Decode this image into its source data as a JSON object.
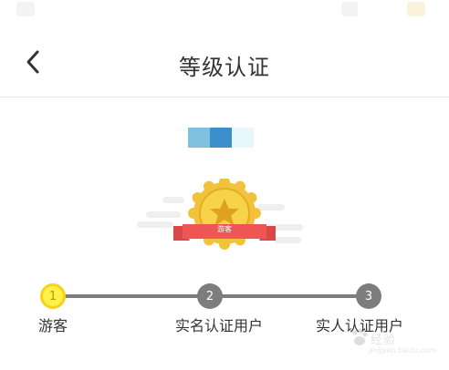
{
  "header": {
    "title": "等级认证",
    "back_icon": "chevron-left-icon"
  },
  "level": {
    "badge_text": "游客",
    "badge_colors": {
      "gold": "#F2C33A",
      "gold_light": "#F7D34A",
      "ribbon": "#EE5555"
    }
  },
  "steps": [
    {
      "number": "1",
      "label": "游客",
      "state": "current"
    },
    {
      "number": "2",
      "label": "实名认证用户",
      "state": "pending"
    },
    {
      "number": "3",
      "label": "实人认证用户",
      "state": "pending"
    }
  ],
  "watermark": {
    "brand": "经验",
    "site": "jingyan.baidu.com"
  },
  "colors": {
    "active_step": "#FFF04A",
    "inactive_step": "#7D7D7D",
    "text": "#333333"
  }
}
